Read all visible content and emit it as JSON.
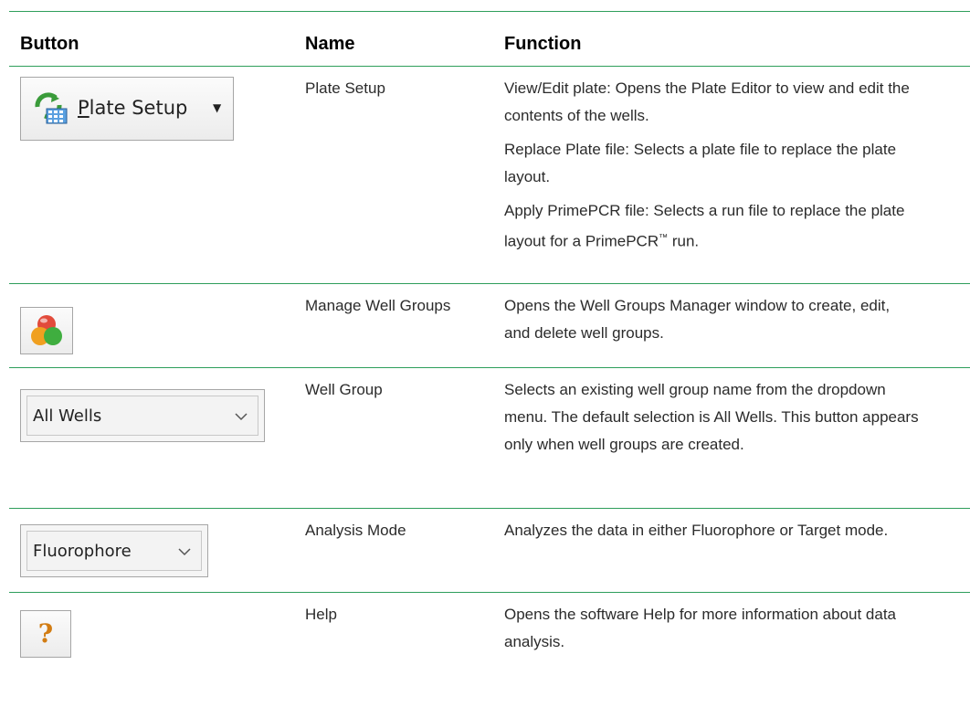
{
  "header": {
    "button": "Button",
    "name": "Name",
    "function": "Function"
  },
  "rows": [
    {
      "icon": "plate-setup-icon",
      "button_text_underlined": "P",
      "button_text_rest": "late Setup",
      "name": "Plate Setup",
      "functions": [
        "View/Edit plate: Opens the Plate Editor to view and edit the contents of the wells.",
        "Replace Plate file: Selects a plate file to replace the plate layout.",
        "Apply PrimePCR file: Selects a run file to replace the plate layout for a PrimePCR™ run."
      ]
    },
    {
      "icon": "well-groups-icon",
      "name": "Manage Well Groups",
      "functions": [
        "Opens the Well Groups Manager window to create, edit, and delete well groups."
      ]
    },
    {
      "icon": "dropdown-icon",
      "button_text": "All Wells",
      "name": "Well Group",
      "functions": [
        "Selects an existing well group name from the dropdown menu. The default selection is All Wells. This button appears only when well groups are created."
      ]
    },
    {
      "icon": "dropdown-icon",
      "button_text": "Fluorophore",
      "name": "Analysis Mode",
      "functions": [
        "Analyzes the data in either Fluorophore or Target mode."
      ]
    },
    {
      "icon": "help-icon",
      "button_text": "?",
      "name": "Help",
      "functions": [
        "Opens the software Help for more information about data analysis."
      ]
    }
  ],
  "colors": {
    "rule": "#2e9e5b",
    "help_question": "#d27c12"
  }
}
